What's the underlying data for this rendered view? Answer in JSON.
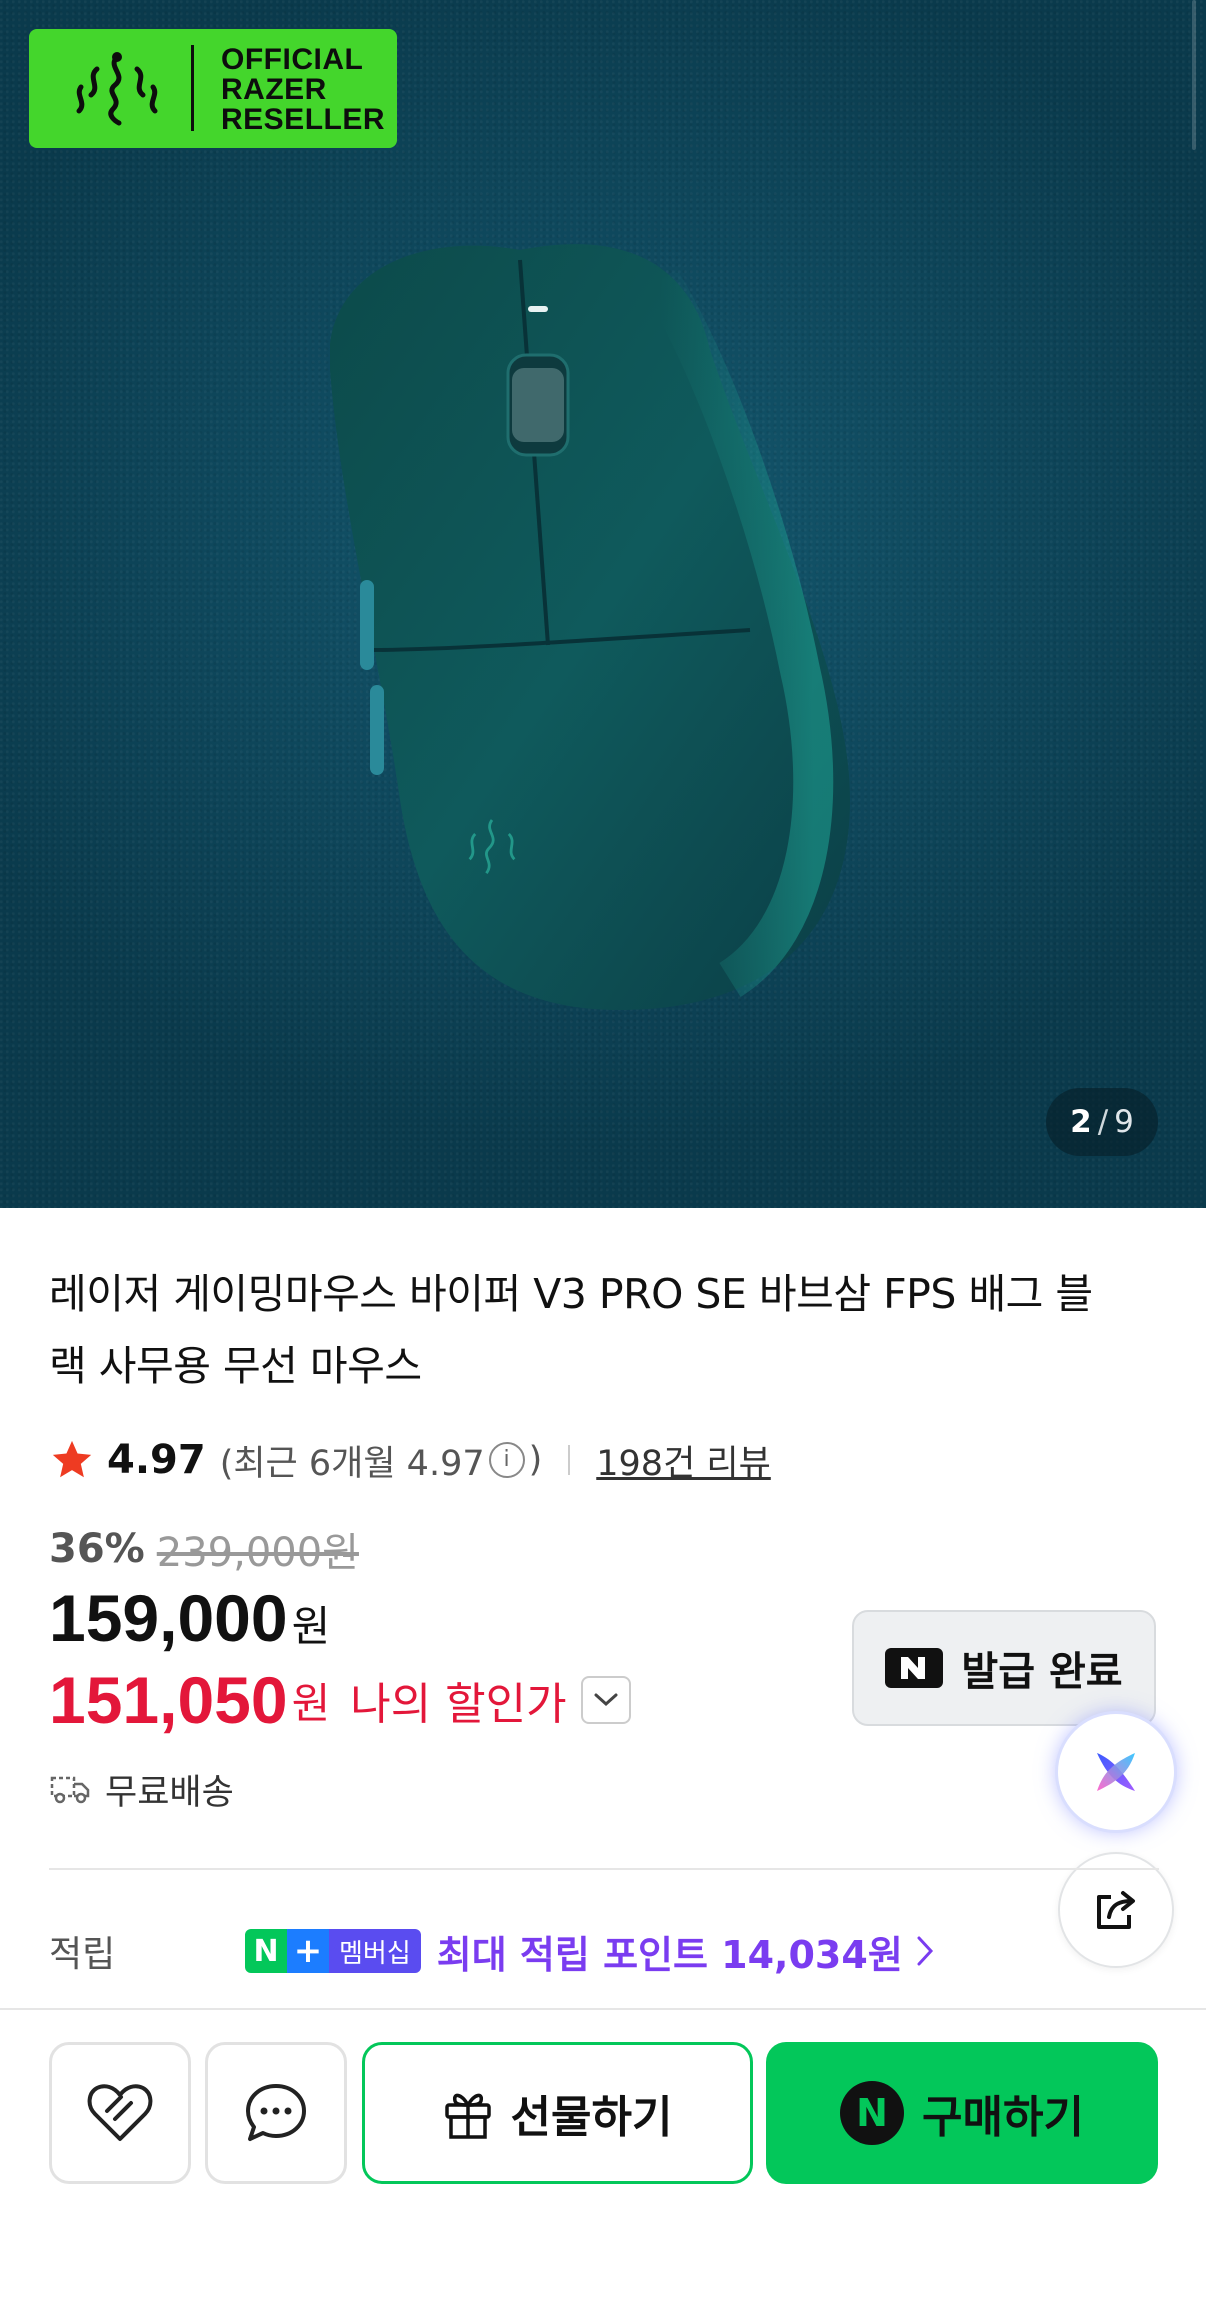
{
  "hero": {
    "badge_lines": [
      "OFFICIAL",
      "RAZER",
      "RESELLER"
    ],
    "counter_current": "2",
    "counter_separator": "/",
    "counter_total": "9",
    "background_color": "#0f4a5f"
  },
  "product": {
    "title": "레이저 게이밍마우스 바이퍼 V3 PRO SE 바브삼 FPS 배그 블랙 사무용 무선 마우스",
    "rating": "4.97",
    "recent_rating_prefix": "(최근 6개월 4.97",
    "info_icon": "i",
    "recent_rating_suffix": ")",
    "review_count": "198건 리뷰",
    "discount_pct": "36%",
    "original_price": "239,000원",
    "price": "159,000",
    "price_unit": "원",
    "my_price": "151,050",
    "my_price_unit": "원",
    "my_price_label": "나의 할인가",
    "shipping": "무료배송"
  },
  "coupon": {
    "label": "발급 완료"
  },
  "points": {
    "label": "적립",
    "badge_n": "N",
    "badge_plus": "+",
    "badge_text": "멤버십",
    "text": "최대 적립 포인트 14,034원"
  },
  "bottom_bar": {
    "gift_label": "선물하기",
    "buy_label": "구매하기",
    "buy_logo": "N"
  },
  "icons": {
    "razer": "razer-snake-icon",
    "star": "star-icon",
    "truck": "truck-icon",
    "chevron": "chevron-down-icon",
    "ai": "ai-assistant-icon",
    "share": "share-icon",
    "heart": "heart-icon",
    "chat": "chat-icon",
    "gift": "gift-icon"
  },
  "colors": {
    "brand_green": "#03c75a",
    "razer_green": "#44d62c",
    "discount_red": "#e3173a",
    "points_purple": "#7a3cf0"
  }
}
